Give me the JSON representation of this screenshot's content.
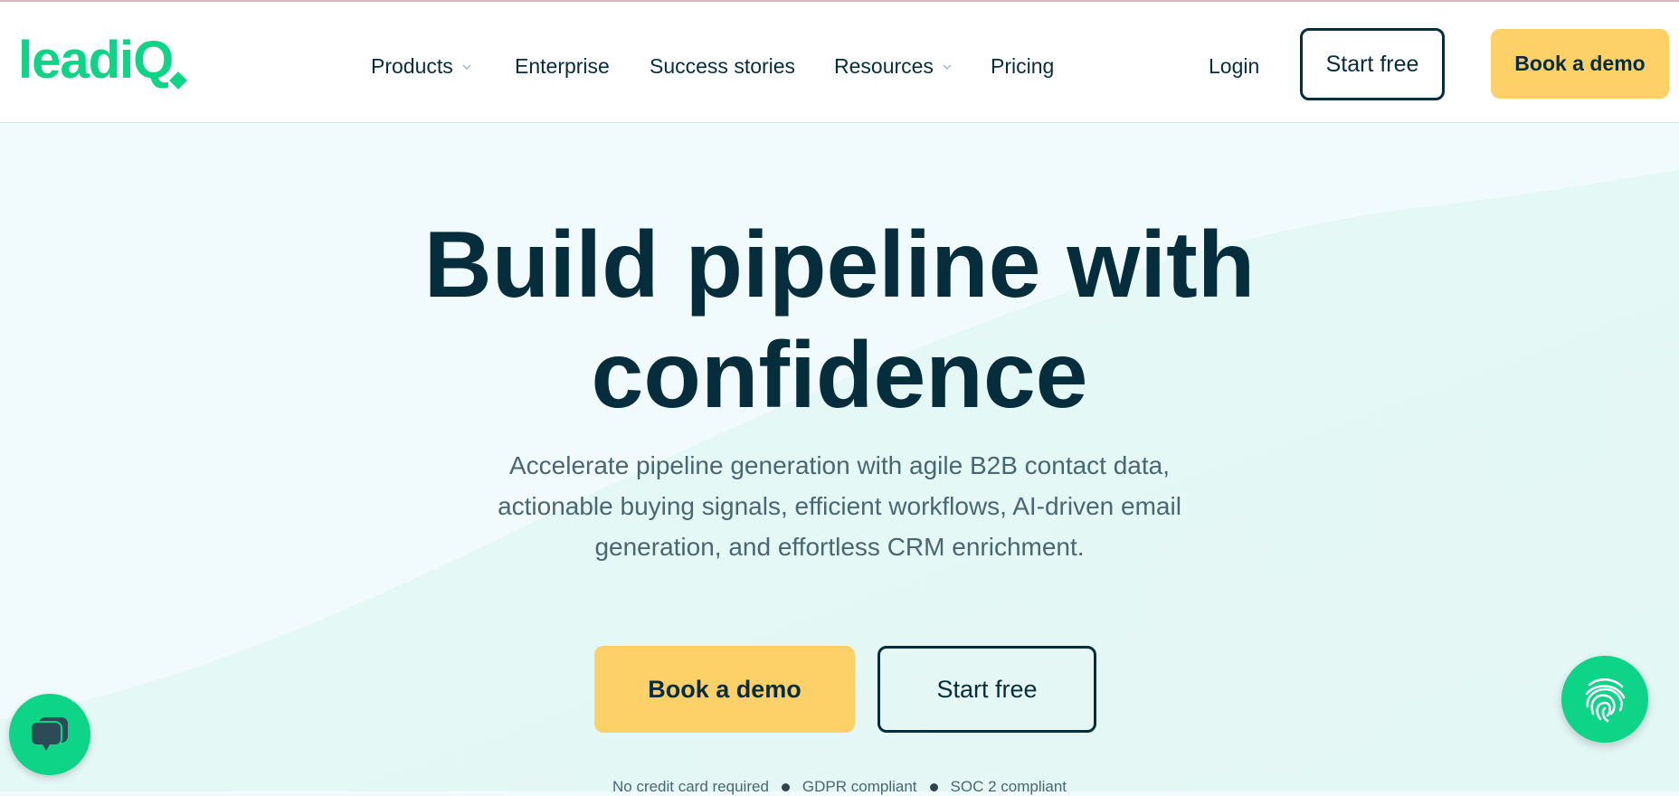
{
  "colors": {
    "brand_green": "#0ed487",
    "navy": "#062d3c",
    "yellow": "#fdd167",
    "muted_text": "#4a6670",
    "hero_bg": "#f1fafc"
  },
  "header": {
    "logo_text": "leadiQ",
    "nav": [
      {
        "label": "Products",
        "has_dropdown": true
      },
      {
        "label": "Enterprise",
        "has_dropdown": false
      },
      {
        "label": "Success stories",
        "has_dropdown": false
      },
      {
        "label": "Resources",
        "has_dropdown": true
      },
      {
        "label": "Pricing",
        "has_dropdown": false
      }
    ],
    "login_label": "Login",
    "start_free_label": "Start free",
    "book_demo_label": "Book a demo"
  },
  "hero": {
    "headline_line1": "Build pipeline with",
    "headline_line2": "confidence",
    "subtitle_lines": [
      "Accelerate pipeline generation with agile B2B contact data,",
      "actionable buying signals, efficient workflows, AI-driven email",
      "generation, and effortless CRM enrichment."
    ],
    "cta_primary": "Book a demo",
    "cta_secondary": "Start free",
    "badges": [
      "No credit card required",
      "GDPR compliant",
      "SOC 2 compliant"
    ]
  },
  "widgets": {
    "chat_icon": "chat-bubbles-icon",
    "fingerprint_icon": "fingerprint-icon"
  }
}
